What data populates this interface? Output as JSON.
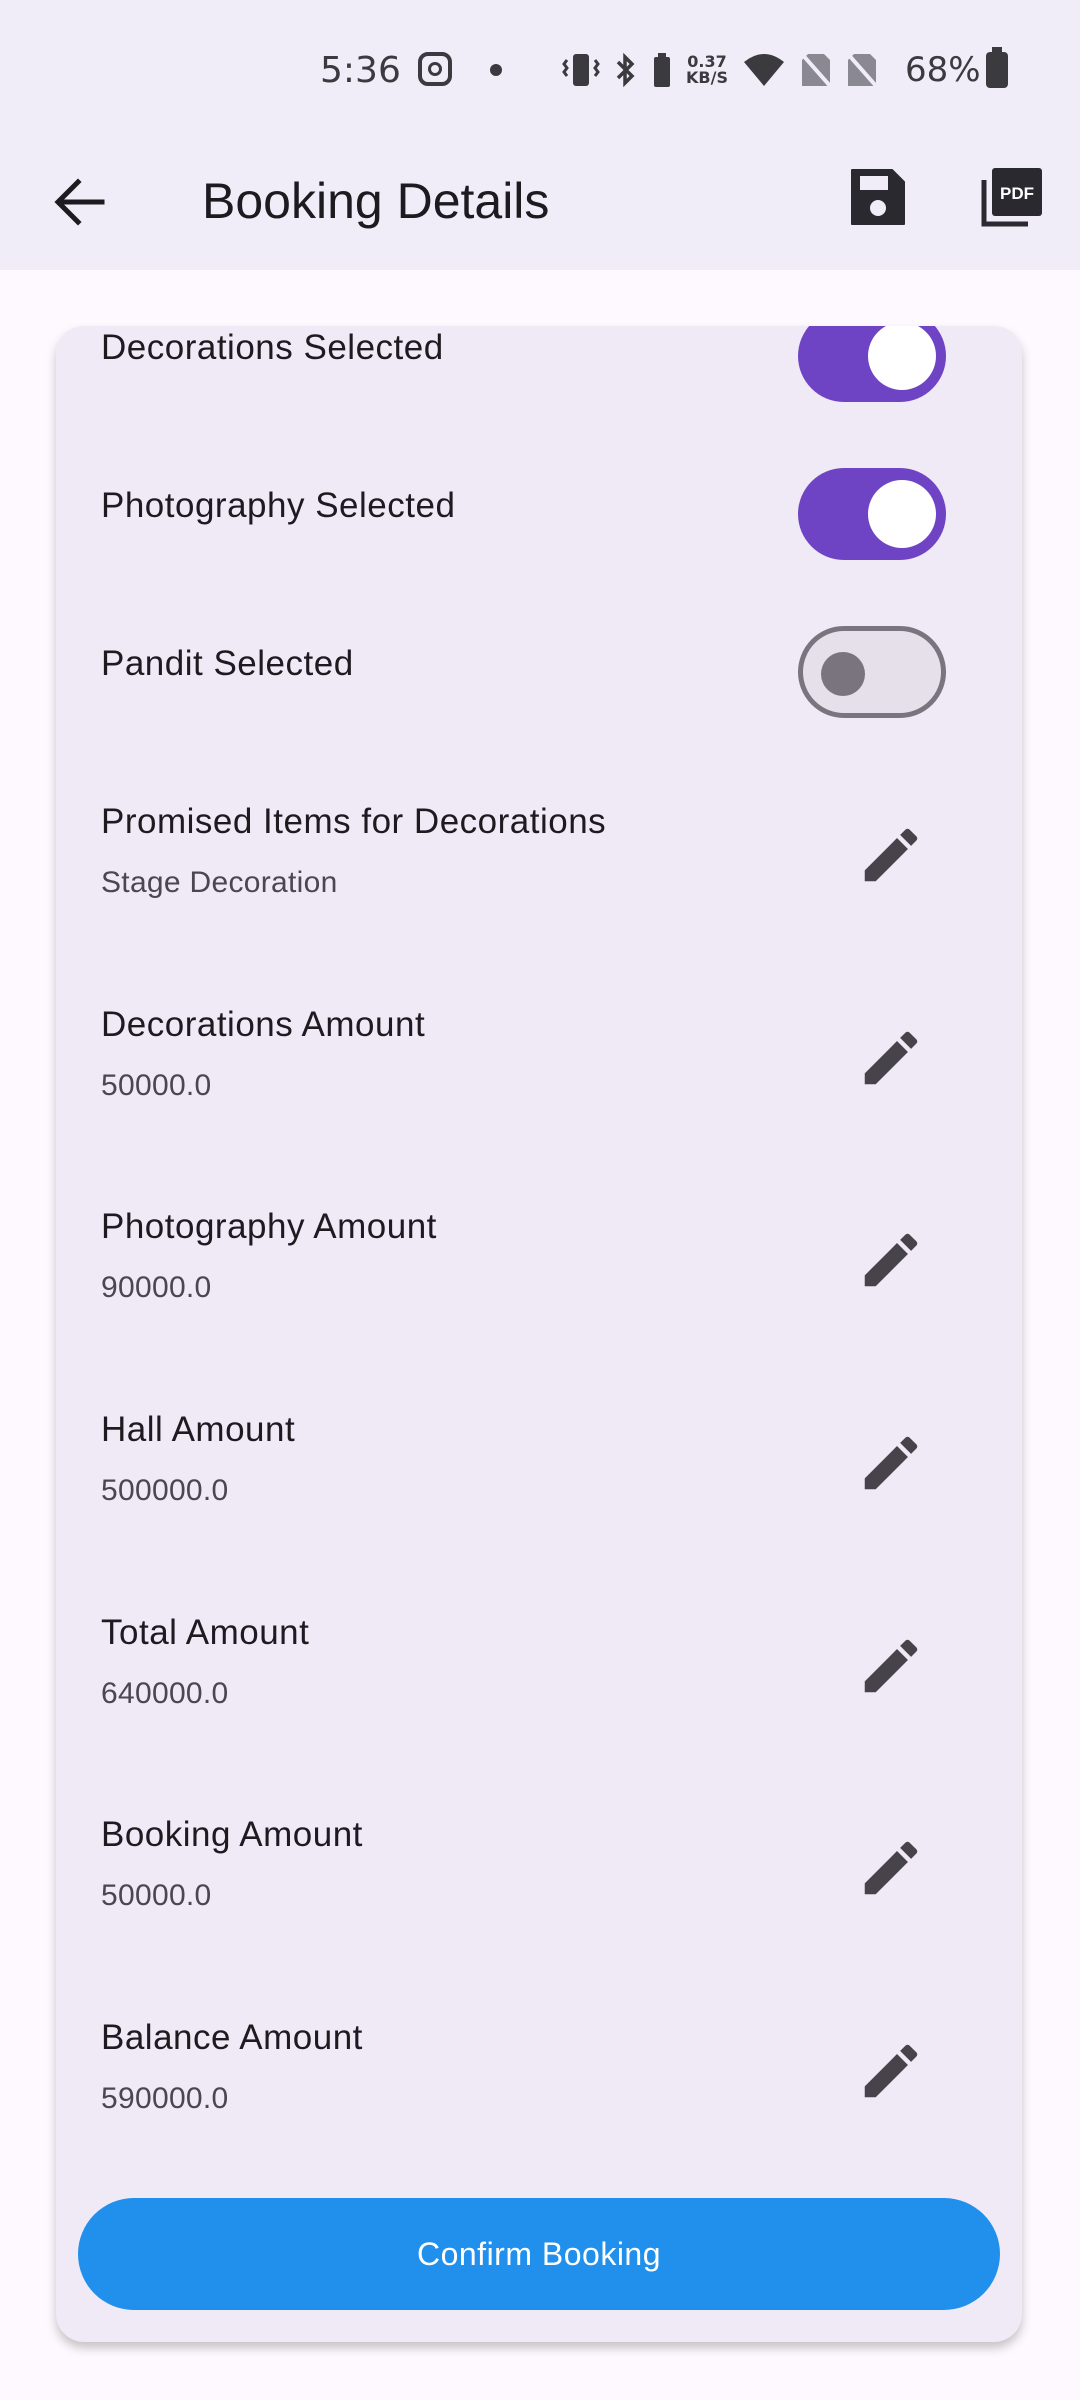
{
  "status_bar": {
    "time": "5:36",
    "network_speed": "0.37",
    "network_speed_unit": "KB/S",
    "battery": "68%",
    "icons": [
      "instagram-icon",
      "notification-dot",
      "vibrate-icon",
      "bluetooth-icon",
      "wifi-icon",
      "no-sim-icon",
      "no-sim-icon",
      "battery-icon"
    ]
  },
  "appbar": {
    "title": "Booking Details",
    "icons": [
      "back-arrow-icon",
      "save-icon",
      "pdf-icon"
    ]
  },
  "switches": [
    {
      "label": "Decorations Selected",
      "on": true
    },
    {
      "label": "Photography Selected",
      "on": true
    },
    {
      "label": "Pandit Selected",
      "on": false
    }
  ],
  "items": [
    {
      "label": "Promised Items for Decorations",
      "value": "Stage Decoration"
    },
    {
      "label": "Decorations Amount",
      "value": "50000.0"
    },
    {
      "label": "Photography Amount",
      "value": "90000.0"
    },
    {
      "label": "Hall Amount",
      "value": "500000.0"
    },
    {
      "label": "Total Amount",
      "value": "640000.0"
    },
    {
      "label": "Booking Amount",
      "value": "50000.0"
    },
    {
      "label": "Balance Amount",
      "value": "590000.0"
    }
  ],
  "confirm_button": "Confirm Booking",
  "colors": {
    "accent": "#6e44c4",
    "button": "#2090ec",
    "card": "#f0e9f6",
    "appbar": "#f1edf8"
  }
}
